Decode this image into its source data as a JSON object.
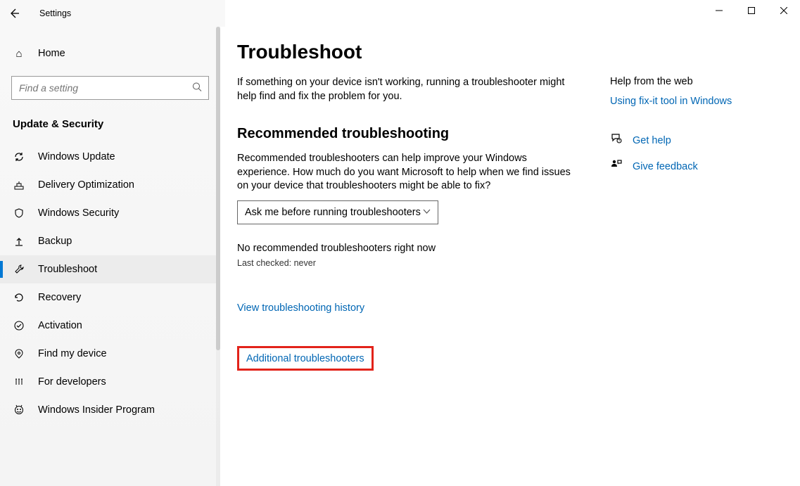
{
  "window": {
    "title": "Settings"
  },
  "search": {
    "placeholder": "Find a setting"
  },
  "home_label": "Home",
  "group_header": "Update & Security",
  "sidebar": {
    "items": [
      {
        "label": "Windows Update"
      },
      {
        "label": "Delivery Optimization"
      },
      {
        "label": "Windows Security"
      },
      {
        "label": "Backup"
      },
      {
        "label": "Troubleshoot"
      },
      {
        "label": "Recovery"
      },
      {
        "label": "Activation"
      },
      {
        "label": "Find my device"
      },
      {
        "label": "For developers"
      },
      {
        "label": "Windows Insider Program"
      }
    ]
  },
  "page": {
    "title": "Troubleshoot",
    "intro": "If something on your device isn't working, running a troubleshooter might help find and fix the problem for you.",
    "section_title": "Recommended troubleshooting",
    "section_body": "Recommended troubleshooters can help improve your Windows experience. How much do you want Microsoft to help when we find issues on your device that troubleshooters might be able to fix?",
    "select_value": "Ask me before running troubleshooters",
    "status": "No recommended troubleshooters right now",
    "status_sub": "Last checked: never",
    "history_link": "View troubleshooting history",
    "additional_link": "Additional troubleshooters"
  },
  "right": {
    "help_header": "Help from the web",
    "help_link": "Using fix-it tool in Windows",
    "get_help": "Get help",
    "give_feedback": "Give feedback"
  }
}
